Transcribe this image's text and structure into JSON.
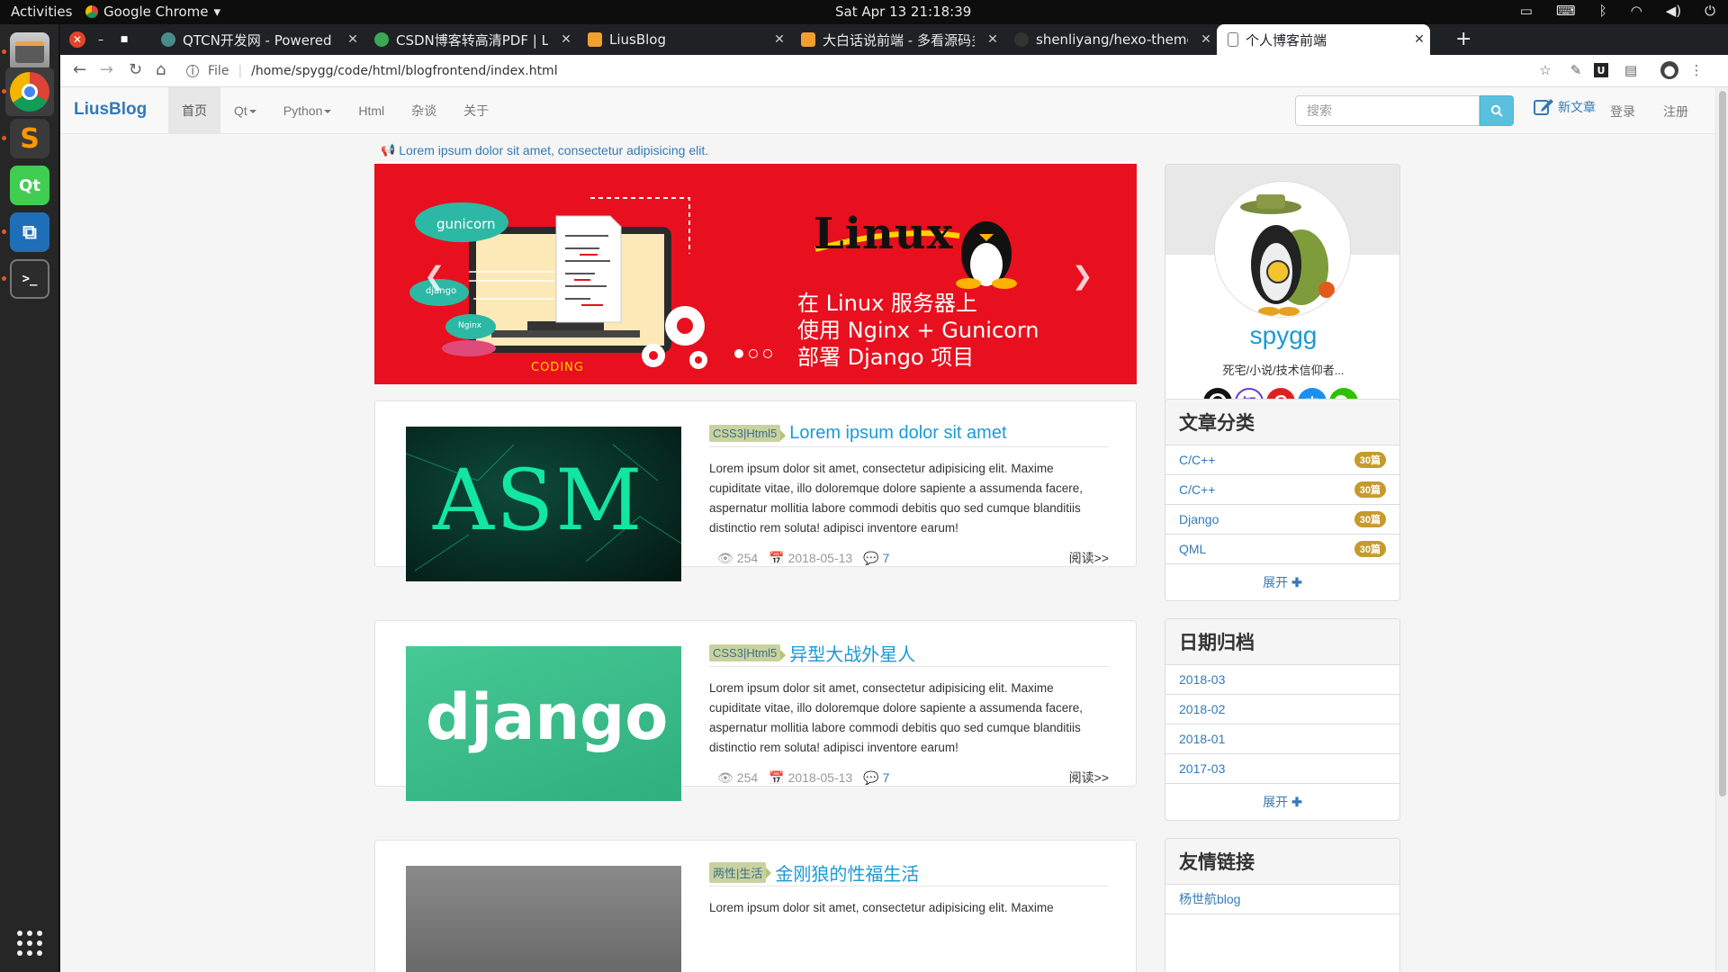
{
  "desktop": {
    "activities": "Activities",
    "app_menu": "Google Chrome",
    "clock": "Sat Apr 13  21:18:39"
  },
  "browser": {
    "tabs": [
      {
        "title": "QTCN开发网 - Powered by",
        "favicon_color": "#4a8a8c"
      },
      {
        "title": "CSDN博客转高清PDF | Liu",
        "favicon_color": "#3aa757"
      },
      {
        "title": "LiusBlog",
        "favicon_color": "#f0a030"
      },
      {
        "title": "大白话说前端 - 多看源码多",
        "favicon_color": "#f0a030"
      },
      {
        "title": "shenliyang/hexo-theme-s",
        "favicon_color": "#333333"
      },
      {
        "title": "个人博客前端",
        "favicon_color": "#888888"
      }
    ],
    "scheme_label": "File",
    "url": "/home/spygg/code/html/blogfrontend/index.html"
  },
  "site": {
    "brand": "LiusBlog",
    "nav": [
      {
        "label": "首页",
        "dropdown": false
      },
      {
        "label": "Qt",
        "dropdown": true
      },
      {
        "label": "Python",
        "dropdown": true
      },
      {
        "label": "Html",
        "dropdown": false
      },
      {
        "label": "杂谈",
        "dropdown": false
      },
      {
        "label": "关于",
        "dropdown": false
      }
    ],
    "search_placeholder": "搜索",
    "new_article": "新文章",
    "login": "登录",
    "register": "注册",
    "announcement": "Lorem ipsum dolor sit amet, consectetur adipisicing elit."
  },
  "carousel": {
    "brand_text": "Linux",
    "slogan_lines": [
      "在 Linux 服务器上",
      "使用 Nginx + Gunicorn",
      "部署 Django 项目"
    ],
    "badges": [
      "gunicorn",
      "django",
      "Nginx"
    ],
    "footer_text": "CODING",
    "slide_count": 3,
    "active_slide": 1
  },
  "articles": [
    {
      "tag": "CSS3|Html5",
      "title": "Lorem ipsum dolor sit amet",
      "thumb_text": "ASM",
      "summary": "Lorem ipsum dolor sit amet, consectetur adipisicing elit. Maxime cupiditate vitae, illo doloremque dolore sapiente a assumenda facere, aspernatur mollitia labore commodi debitis quo sed cumque blanditiis distinctio rem soluta! adipisci inventore earum!",
      "views": "254",
      "date": "2018-05-13",
      "comments": "7",
      "read_more": "阅读>>"
    },
    {
      "tag": "CSS3|Html5",
      "title": "异型大战外星人",
      "thumb_text": "django",
      "summary": "Lorem ipsum dolor sit amet, consectetur adipisicing elit. Maxime cupiditate vitae, illo doloremque dolore sapiente a assumenda facere, aspernatur mollitia labore commodi debitis quo sed cumque blanditiis distinctio rem soluta! adipisci inventore earum!",
      "views": "254",
      "date": "2018-05-13",
      "comments": "7",
      "read_more": "阅读>>"
    },
    {
      "tag": "两性|生活",
      "title": "金刚狼的性福生活",
      "thumb_text": "",
      "summary": "Lorem ipsum dolor sit amet, consectetur adipisicing elit. Maxime",
      "views": "",
      "date": "",
      "comments": "",
      "read_more": ""
    }
  ],
  "profile": {
    "name": "spygg",
    "motto": "死宅/小说/技术信仰者...",
    "socials": [
      "github-icon",
      "zhihu-icon",
      "csdn-icon",
      "alipay-icon",
      "wechat-icon"
    ],
    "zhihu_glyph": "知",
    "alipay_glyph": "支"
  },
  "categories": {
    "title": "文章分类",
    "items": [
      {
        "name": "C/C++",
        "count": "30篇"
      },
      {
        "name": "C/C++",
        "count": "30篇"
      },
      {
        "name": "Django",
        "count": "30篇"
      },
      {
        "name": "QML",
        "count": "30篇"
      }
    ],
    "expand": "展开"
  },
  "archive": {
    "title": "日期归档",
    "items": [
      "2018-03",
      "2018-02",
      "2018-01",
      "2017-03"
    ],
    "expand": "展开"
  },
  "links": {
    "title": "友情链接",
    "items": [
      "杨世航blog"
    ]
  },
  "colors": {
    "brand_blue": "#337ab7",
    "title_blue": "#1a9ad6",
    "carousel_red": "#e8101e",
    "badge_gold": "#c69a2c",
    "search_btn": "#5bc0de"
  }
}
